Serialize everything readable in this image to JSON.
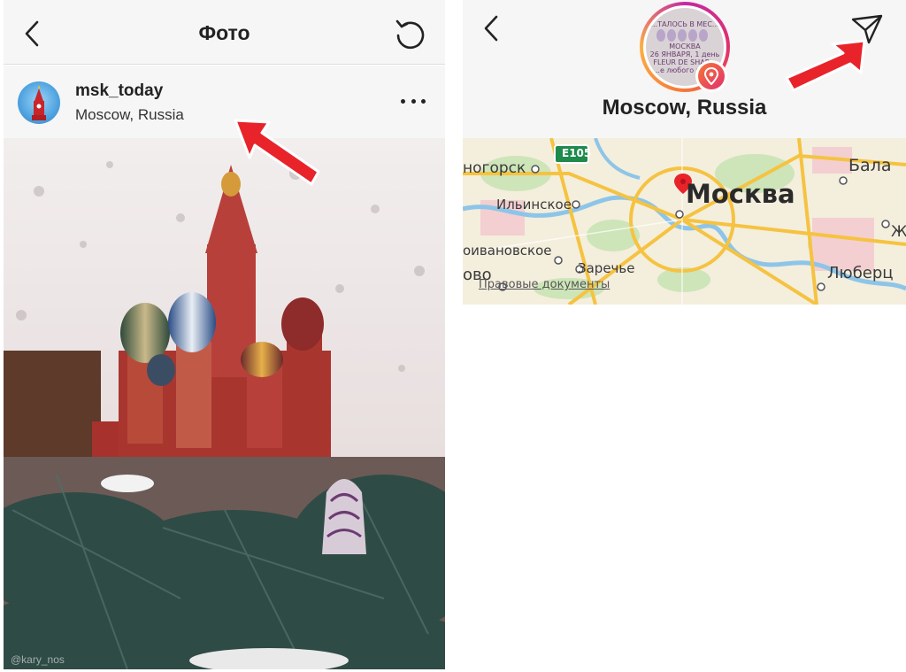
{
  "left_screen": {
    "header": {
      "title": "Фото",
      "back_icon": "chevron-left-icon",
      "refresh_icon": "refresh-icon"
    },
    "post": {
      "username": "msk_today",
      "location": "Moscow, Russia",
      "more_icon": "more-horizontal-icon",
      "photo_credit": "@kary_nos"
    }
  },
  "right_screen": {
    "header": {
      "title": "Moscow, Russia",
      "back_icon": "chevron-left-icon",
      "share_icon": "paper-plane-icon",
      "location_badge_icon": "location-pin-icon",
      "avatar_text": [
        "...ТАЛОСЬ В МЕС...",
        "МОСКВА",
        "26 ЯНВАРЯ, 1 день",
        "FLEUR DE SHAR...",
        "...е любого мас..."
      ]
    },
    "map": {
      "city_label": "Москва",
      "road_badge": "E105",
      "places": [
        "ногорск",
        "Ильинское",
        "оивановское",
        "Заречье",
        "ово",
        "Бала",
        "Ж",
        "Люберц"
      ],
      "legal_link": "Правовые документы"
    }
  },
  "colors": {
    "header_bg": "#f6f6f6",
    "annotation_arrow": "#e8232a",
    "map_pin": "#e8232a",
    "instagram_gradient": [
      "#c32aa3",
      "#e1306c",
      "#f77737",
      "#fcaf45"
    ]
  }
}
